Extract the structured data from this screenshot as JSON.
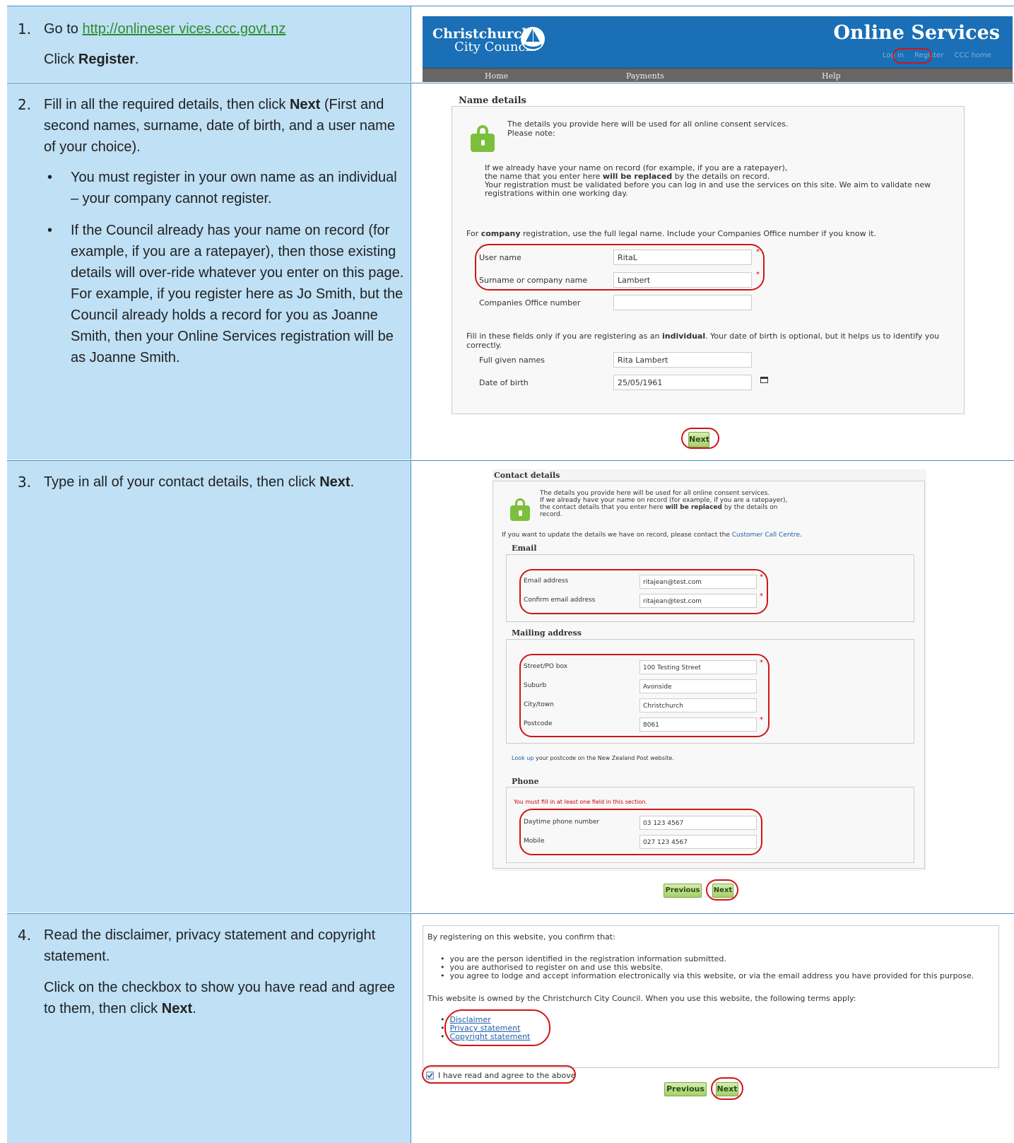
{
  "steps": [
    {
      "number": "1.",
      "lines": [
        {
          "pre": "Go to ",
          "link": "http://onlineser vices.ccc.govt.nz"
        },
        {
          "pre": "Click ",
          "bold": "Register",
          "post": "."
        }
      ]
    },
    {
      "number": "2.",
      "intro": {
        "pre": "Fill in all the required details, then click ",
        "bold": "Next",
        "post": " (First and second names, surname, date of birth, and a user name of your choice)."
      },
      "bullets": [
        "You must register in your own name as an individual – your company cannot register.",
        "If the Council already has your name on record (for example, if you are a ratepayer), then those existing details will over-ride whatever you enter on this page. For example, if you register here as Jo Smith, but the Council already holds a record for you as Joanne Smith, then your Online Services registration will be as Joanne Smith."
      ]
    },
    {
      "number": "3.",
      "intro": {
        "pre": "Type in all of your contact details, then click ",
        "bold": "Next",
        "post": "."
      }
    },
    {
      "number": "4.",
      "intro": {
        "pre": "Read the disclaimer, privacy statement and copyright statement."
      },
      "second": {
        "pre": "Click on the checkbox to show you have read and agree to them, then click ",
        "bold": "Next",
        "post": "."
      }
    }
  ],
  "banner": {
    "logo_line1": "Christchurch",
    "logo_line2": "City Council",
    "title": "Online Services",
    "top_links": [
      "Log in",
      "Register",
      "CCC home"
    ],
    "nav": [
      "Home",
      "Payments",
      "Help"
    ]
  },
  "name_form": {
    "section_title": "Name details",
    "intro1": "The details you provide here will be used for all online consent services.",
    "intro2": "Please note:",
    "note_pre": "If we already have your name on record (for example, if you are a ratepayer),",
    "note_line2_pre": "the name that you enter here ",
    "note_line2_bold": "will be replaced",
    "note_line2_post": " by the details on record.",
    "note_line3": "Your registration must be validated before you can log in and use the services on this site. We aim to validate new",
    "note_line4": "registrations within one working day.",
    "company_pre": "For ",
    "company_bold": "company",
    "company_post": " registration, use the full legal name. Include your Companies Office number if you know it.",
    "fields": [
      {
        "label": "User name",
        "value": "RitaL"
      },
      {
        "label": "Surname or company name",
        "value": "Lambert"
      },
      {
        "label": "Companies Office number",
        "value": ""
      }
    ],
    "indiv_pre": "Fill in these fields only if you are registering as an ",
    "indiv_bold": "individual",
    "indiv_post": ". Your date of birth is optional, but it helps us to identify you correctly.",
    "indiv_fields": [
      {
        "label": "Full given names",
        "value": "Rita Lambert"
      },
      {
        "label": "Date of birth",
        "value": "25/05/1961"
      }
    ],
    "next": "Next"
  },
  "contact_form": {
    "section_title": "Contact details",
    "intro1": "The details you provide here will be used for all online consent services.",
    "intro2": "If we already have your name on record (for example, if you are a ratepayer),",
    "intro3_pre": "the contact details that you enter here ",
    "intro3_bold": "will be replaced",
    "intro3_post": " by the details on",
    "intro4": "record.",
    "update_pre": "If you want to update the details we have on record, please contact the ",
    "update_link": "Customer Call Centre",
    "update_post": ".",
    "email_title": "Email",
    "email_fields": [
      {
        "label": "Email address",
        "value": "ritajean@test.com"
      },
      {
        "label": "Confirm email address",
        "value": "ritajean@test.com"
      }
    ],
    "mail_title": "Mailing address",
    "mail_fields": [
      {
        "label": "Street/PO box",
        "value": "100 Testing Street"
      },
      {
        "label": "Suburb",
        "value": "Avonside"
      },
      {
        "label": "City/town",
        "value": "Christchurch"
      },
      {
        "label": "Postcode",
        "value": "8061"
      }
    ],
    "lookup_link": "Look up",
    "lookup_post": " your postcode on the New Zealand Post website.",
    "phone_title": "Phone",
    "phone_warning": "You must fill in at least one field in this section.",
    "phone_fields": [
      {
        "label": "Daytime phone number",
        "value": "03 123 4567"
      },
      {
        "label": "Mobile",
        "value": "027 123 4567"
      }
    ],
    "previous": "Previous",
    "next": "Next"
  },
  "disclaimer": {
    "intro": "By registering on this website, you confirm that:",
    "bullets": [
      "you are the person identified in the registration information submitted.",
      "you are authorised to register on and use this website.",
      "you agree to lodge and accept information electronically via this website, or via the email address you have provided for this purpose."
    ],
    "owned": "This website is owned by the Christchurch City Council. When you use this website, the following terms apply:",
    "links": [
      "Disclaimer",
      "Privacy statement",
      "Copyright statement"
    ],
    "checkbox_label": "I have read and agree to the above",
    "previous": "Previous",
    "next": "Next"
  },
  "colors": {
    "cell_blue": "#bfe0f5",
    "border_blue": "#4a8fc4",
    "accent_green": "#7cbf3c",
    "highlight_red": "#d01616"
  }
}
